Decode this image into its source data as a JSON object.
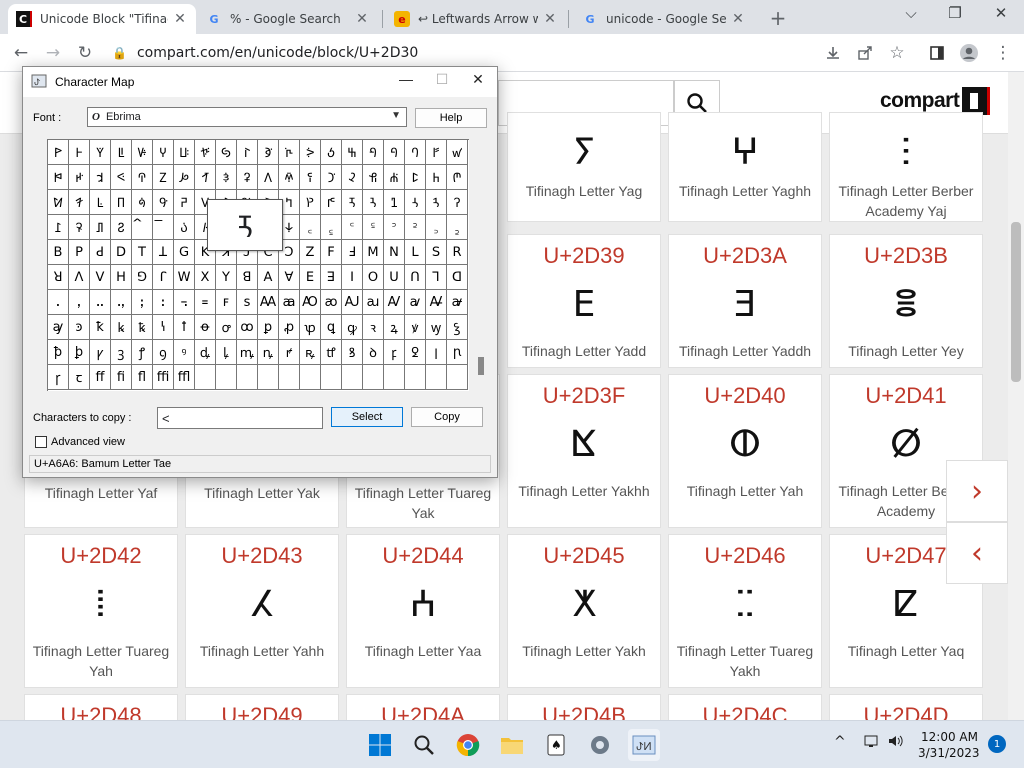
{
  "browser": {
    "tabs": [
      {
        "title": "Unicode Block \"Tifinag",
        "icon": "compart-favicon",
        "active": true
      },
      {
        "title": "% - Google Search",
        "icon": "google-favicon",
        "active": false
      },
      {
        "title": "↩ Leftwards Arrow wit",
        "icon": "emojipedia-favicon",
        "active": false
      },
      {
        "title": "unicode - Google Sear",
        "icon": "google-favicon",
        "active": false
      }
    ],
    "new_tab": "+",
    "window_controls": {
      "minimize": "⌵",
      "restore": "❐",
      "close": "✕"
    },
    "nav": {
      "back": "←",
      "forward": "→",
      "reload": "↻"
    },
    "url": "compart.com/en/unicode/block/U+2D30",
    "toolbar_icons": [
      "download-icon",
      "share-icon",
      "bookmark-star-icon",
      "sidepanel-icon",
      "profile-icon",
      "menu-icon"
    ]
  },
  "site": {
    "logo_text": "compart",
    "search_placeholder": "",
    "next_arrow": "›",
    "prev_arrow": "‹"
  },
  "cards": [
    {
      "code": "",
      "glyph": "ⵢ",
      "name": "Tifinagh Letter Yag"
    },
    {
      "code": "",
      "glyph": "ⵖ",
      "name": "Tifinagh Letter Yaghh"
    },
    {
      "code": "",
      "glyph": "ⵗ",
      "name": "Tifinagh Letter Berber Academy Yaj"
    },
    {
      "code": "U+2D39",
      "glyph": "ⴹ",
      "name": "Tifinagh Letter Yadd"
    },
    {
      "code": "U+2D3A",
      "glyph": "ⴺ",
      "name": "Tifinagh Letter Yaddh"
    },
    {
      "code": "U+2D3B",
      "glyph": "ⴻ",
      "name": "Tifinagh Letter Yey"
    },
    {
      "code": "U+2D3F",
      "glyph": "ⴿ",
      "name": "Tifinagh Letter Yakhh"
    },
    {
      "code": "U+2D40",
      "glyph": "ⵀ",
      "name": "Tifinagh Letter Yah"
    },
    {
      "code": "U+2D41",
      "glyph": "ⵁ",
      "name": "Tifinagh Letter Berber Academy"
    },
    {
      "code": "",
      "glyph": "",
      "name": "Tifinagh Letter Yaf"
    },
    {
      "code": "",
      "glyph": "",
      "name": "Tifinagh Letter Yak"
    },
    {
      "code": "",
      "glyph": "",
      "name": "Tifinagh Letter Tuareg Yak"
    },
    {
      "code": "U+2D42",
      "glyph": "ⵂ",
      "name": "Tifinagh Letter Tuareg Yah"
    },
    {
      "code": "U+2D43",
      "glyph": "ⵃ",
      "name": "Tifinagh Letter Yahh"
    },
    {
      "code": "U+2D44",
      "glyph": "ⵄ",
      "name": "Tifinagh Letter Yaa"
    },
    {
      "code": "U+2D45",
      "glyph": "ⵅ",
      "name": "Tifinagh Letter Yakh"
    },
    {
      "code": "U+2D46",
      "glyph": "ⵆ",
      "name": "Tifinagh Letter Tuareg Yakh"
    },
    {
      "code": "U+2D47",
      "glyph": "ⵇ",
      "name": "Tifinagh Letter Yaq"
    },
    {
      "code": "U+2D48",
      "glyph": "",
      "name": ""
    },
    {
      "code": "U+2D49",
      "glyph": "",
      "name": ""
    },
    {
      "code": "U+2D4A",
      "glyph": "",
      "name": ""
    },
    {
      "code": "U+2D4B",
      "glyph": "",
      "name": ""
    },
    {
      "code": "U+2D4C",
      "glyph": "",
      "name": ""
    },
    {
      "code": "U+2D4D",
      "glyph": "",
      "name": ""
    }
  ],
  "charmap": {
    "title": "Character Map",
    "font_label": "Font :",
    "font_value": "Ebrima",
    "help_label": "Help",
    "grid_chars": [
      "ꚰ",
      "ꚱ",
      "ꚲ",
      "ꚳ",
      "ꚴ",
      "ꚵ",
      "ꚶ",
      "ꚷ",
      "ꚸ",
      "ꚹ",
      "ꚺ",
      "ꚻ",
      "ꚼ",
      "ꚽ",
      "ꚾ",
      "ꚿ",
      "ꛀ",
      "ꛁ",
      "ꛂ",
      "ꛃ",
      "ꛄ",
      "ꛅ",
      "ꛆ",
      "ꛇ",
      "ꛈ",
      "ꛉ",
      "ꛊ",
      "ꛋ",
      "ꛌ",
      "ꛍ",
      "ꛎ",
      "ꛏ",
      "ꛐ",
      "ꛑ",
      "ꛒ",
      "ꛓ",
      "ꛔ",
      "ꛕ",
      "ꛖ",
      "ꛗ",
      "ꛘ",
      "ꛙ",
      "ꛚ",
      "ꛛ",
      "ꛜ",
      "ꛝ",
      "ꛞ",
      "ꛟ",
      "ꛠ",
      "ꛡ",
      "ꛢ",
      "ꛣ",
      "ꛤ",
      "ꛥ",
      "ꛦ",
      "ꛧ",
      "ꛨ",
      "ꛩ",
      "ꛪ",
      "ꛫ",
      "ꛬ",
      "ꛭ",
      "ꛮ",
      "ꛯ",
      "꛰",
      "꛱",
      "꛲",
      "꛳",
      "꛴",
      "꛵",
      "꛶",
      "꛷",
      "꜀",
      "꜁",
      "꜂",
      "꜃",
      "꜄",
      "꜅",
      "꜆",
      "꜇",
      "ꓐ",
      "ꓑ",
      "ꓒ",
      "ꓓ",
      "ꓔ",
      "ꓕ",
      "ꓖ",
      "ꓗ",
      "ꓘ",
      "ꓙ",
      "ꓚ",
      "ꓛ",
      "ꓜ",
      "ꓝ",
      "ꓞ",
      "ꓟ",
      "ꓠ",
      "ꓡ",
      "ꓢ",
      "ꓣ",
      "ꓤ",
      "ꓥ",
      "ꓦ",
      "ꓧ",
      "ꓨ",
      "ꓩ",
      "ꓪ",
      "ꓫ",
      "ꓬ",
      "ꓭ",
      "ꓮ",
      "ꓯ",
      "ꓰ",
      "ꓱ",
      "ꓲ",
      "ꓳ",
      "ꓴ",
      "ꓵ",
      "ꓶ",
      "ꓷ",
      "ꓸ",
      "ꓹ",
      "ꓺ",
      "ꓻ",
      "ꓼ",
      "ꓽ",
      "꓾",
      "꓿",
      "ꜰ",
      "ꜱ",
      "Ꜳ",
      "ꜳ",
      "Ꜵ",
      "ꜵ",
      "Ꜷ",
      "ꜷ",
      "Ꜹ",
      "ꜹ",
      "Ꜻ",
      "ꜻ",
      "ꜽ",
      "ꜿ",
      "ꝁ",
      "ꝃ",
      "ꝅ",
      "ꝇ",
      "ꝉ",
      "ꝋ",
      "ꝍ",
      "ꝏ",
      "ꝑ",
      "ꝓ",
      "ꝕ",
      "ꝗ",
      "ꝙ",
      "ꝛ",
      "ꝝ",
      "ꝟ",
      "ꝡ",
      "ꝣ",
      "ꝥ",
      "ꝧ",
      "ꝩ",
      "ꝫ",
      "ꝭ",
      "ꝯ",
      "ꝰ",
      "ꝱ",
      "ꝲ",
      "ꝳ",
      "ꝴ",
      "ꝵ",
      "ꝶ",
      "ꝷ",
      "ꝸ",
      "ꝺ",
      "ꝼ",
      "ꝿ",
      "ꞁ",
      "ꞃ",
      "ꞅ",
      "ꞇ",
      "ﬀ",
      "ﬁ",
      "ﬂ",
      "ﬃ",
      "ﬄ",
      "",
      "",
      "",
      "",
      "",
      "",
      "",
      "",
      "",
      "",
      "",
      "",
      ""
    ],
    "magnified_char": "ꛦ",
    "copy_label": "Characters to copy :",
    "copy_value": "<",
    "select_label": "Select",
    "copy_button": "Copy",
    "advanced_label": "Advanced view",
    "status": "U+A6A6: Bamum Letter Tae"
  },
  "taskbar": {
    "apps": [
      "windows-start-icon",
      "search-icon",
      "chrome-icon",
      "file-explorer-icon",
      "solitaire-icon",
      "settings-icon",
      "charmap-icon"
    ],
    "tray": {
      "chevron": "^",
      "time": "12:00 AM",
      "date": "3/31/2023",
      "notifications": "1"
    }
  },
  "colors": {
    "accent": "#c0392b",
    "taskbar": "#dfe6ef",
    "tab_strip": "#dee1e6"
  }
}
